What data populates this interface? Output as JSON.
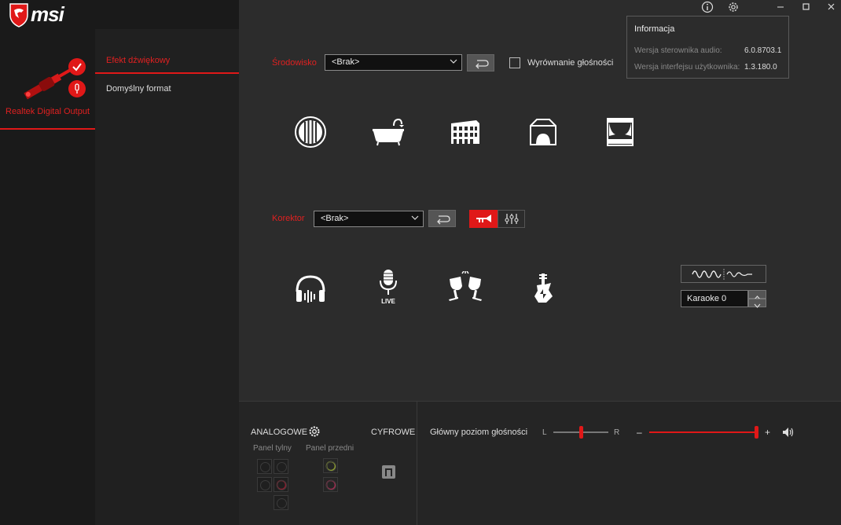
{
  "app": {
    "brand": "msi"
  },
  "device": {
    "name": "Realtek Digital Output"
  },
  "nav": {
    "items": [
      {
        "label": "Efekt dźwiękowy",
        "active": true
      },
      {
        "label": "Domyślny format",
        "active": false
      }
    ]
  },
  "environment": {
    "label": "Środowisko",
    "selected": "<Brak>",
    "loudness_label": "Wyrównanie głośności",
    "icons": [
      "stone-room-icon",
      "bathroom-icon",
      "colosseum-icon",
      "auditorium-icon",
      "stage-icon"
    ]
  },
  "equalizer": {
    "label": "Korektor",
    "selected": "<Brak>",
    "icons": [
      "headphones-icon",
      "live-microphone-icon",
      "party-cheers-icon",
      "rock-guitar-icon"
    ],
    "live_text": "LIVE",
    "karaoke_value": "Karaoke 0"
  },
  "info": {
    "title": "Informacja",
    "rows": [
      {
        "label": "Wersja sterownika audio:",
        "value": "6.0.8703.1"
      },
      {
        "label": "Wersja interfejsu użytkownika:",
        "value": "1.3.180.0"
      }
    ]
  },
  "connectors": {
    "analog_label": "ANALOGOWE",
    "digital_label": "CYFROWE",
    "rear_label": "Panel tylny",
    "front_label": "Panel przedni"
  },
  "volume": {
    "label": "Główny poziom głośności",
    "left": "L",
    "right": "R",
    "minus": "–",
    "plus": "+",
    "balance": 0.5,
    "level": 1.0
  },
  "colors": {
    "accent": "#e01818",
    "background": "#2c2c2c"
  }
}
